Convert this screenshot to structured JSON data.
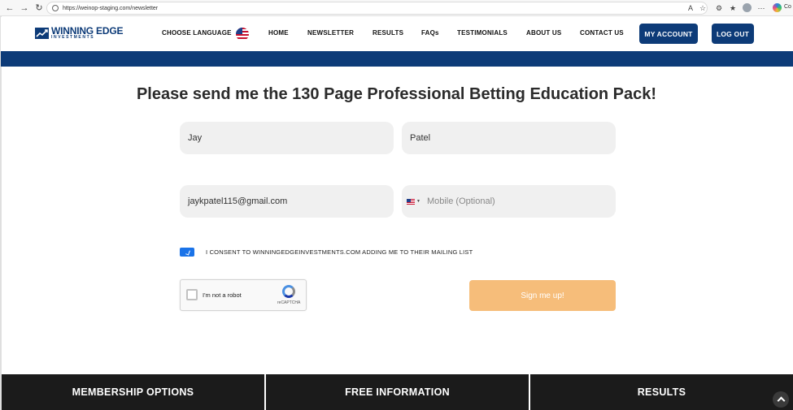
{
  "browser": {
    "url": "https://weinop-staging.com/newsletter",
    "copilot_label": "Co"
  },
  "header": {
    "logo_title": "WINNING EDGE",
    "logo_subtitle": "INVESTMENTS",
    "nav": {
      "choose_language": "CHOOSE LANGUAGE",
      "home": "HOME",
      "newsletter": "NEWSLETTER",
      "results": "RESULTS",
      "faqs": "FAQs",
      "testimonials": "TESTIMONIALS",
      "about_us": "ABOUT US",
      "contact_us": "CONTACT US"
    },
    "my_account": "MY ACCOUNT",
    "log_out": "LOG OUT"
  },
  "form": {
    "headline": "Please send me the 130 Page Professional Betting Education Pack!",
    "first_name": "Jay",
    "last_name": "Patel",
    "email": "jaykpatel115@gmail.com",
    "mobile_placeholder": "Mobile (Optional)",
    "consent": "I CONSENT TO WINNINGEDGEINVESTMENTS.COM ADDING ME TO THEIR MAILING LIST",
    "consent_checked": true,
    "captcha_label": "I'm not a robot",
    "captcha_brand": "reCAPTCHA",
    "submit": "Sign me up!"
  },
  "footer": {
    "col1": "MEMBERSHIP OPTIONS",
    "col2": "FREE INFORMATION",
    "col3": "RESULTS"
  },
  "colors": {
    "brand_navy": "#0d3b78",
    "submit_orange": "#f6bd7a",
    "footer_dark": "#1b1b1b"
  }
}
